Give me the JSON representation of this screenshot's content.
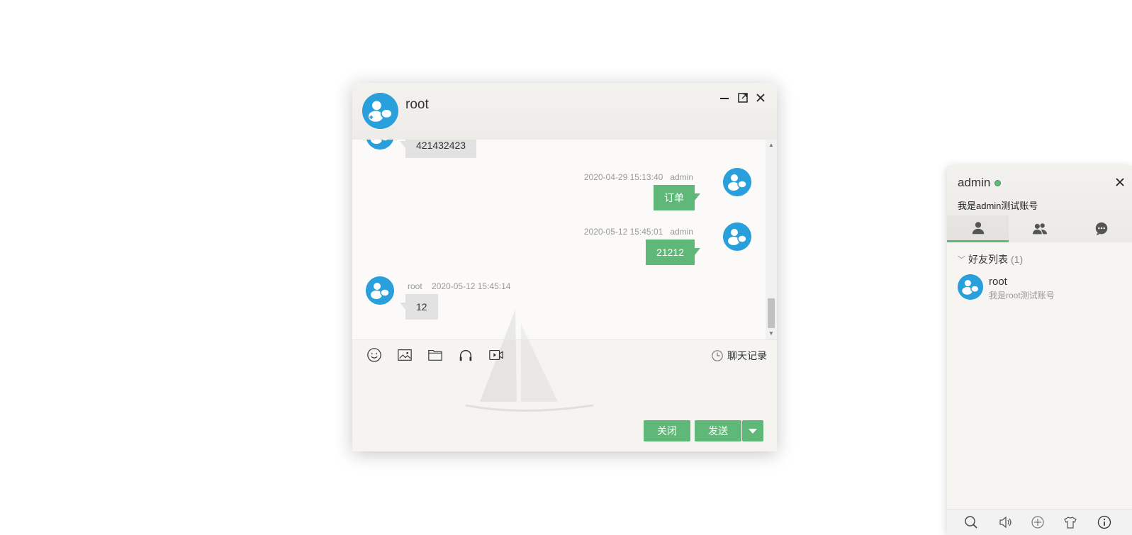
{
  "chat": {
    "title": "root",
    "window_controls": [
      "minimize-icon",
      "maximize-icon",
      "close-icon"
    ],
    "messages": [
      {
        "side": "left",
        "text": "421432423"
      },
      {
        "side": "right",
        "time": "2020-04-29 15:13:40",
        "user": "admin",
        "text": "订单"
      },
      {
        "side": "right",
        "time": "2020-05-12 15:45:01",
        "user": "admin",
        "text": "21212"
      },
      {
        "side": "left",
        "time": "2020-05-12 15:45:14",
        "user": "root",
        "text": "12"
      }
    ],
    "toolbar": {
      "icons": [
        "emoji-icon",
        "image-icon",
        "folder-icon",
        "headphones-icon",
        "video-icon"
      ],
      "history_label": "聊天记录"
    },
    "buttons": {
      "close": "关闭",
      "send": "发送"
    }
  },
  "panel": {
    "username": "admin",
    "signature": "我是admin测试账号",
    "tabs": [
      "friends-icon",
      "groups-icon",
      "chat-history-icon"
    ],
    "group": {
      "name": "好友列表",
      "count": "(1)"
    },
    "friends": [
      {
        "name": "root",
        "sign": "我是root测试账号"
      }
    ],
    "footer_icons": [
      "search-icon",
      "sound-icon",
      "add-icon",
      "skin-icon",
      "info-icon"
    ]
  },
  "colors": {
    "accent": "#5fb878",
    "avatar": "#29a0db",
    "bubble_left": "#e2e2e2"
  }
}
